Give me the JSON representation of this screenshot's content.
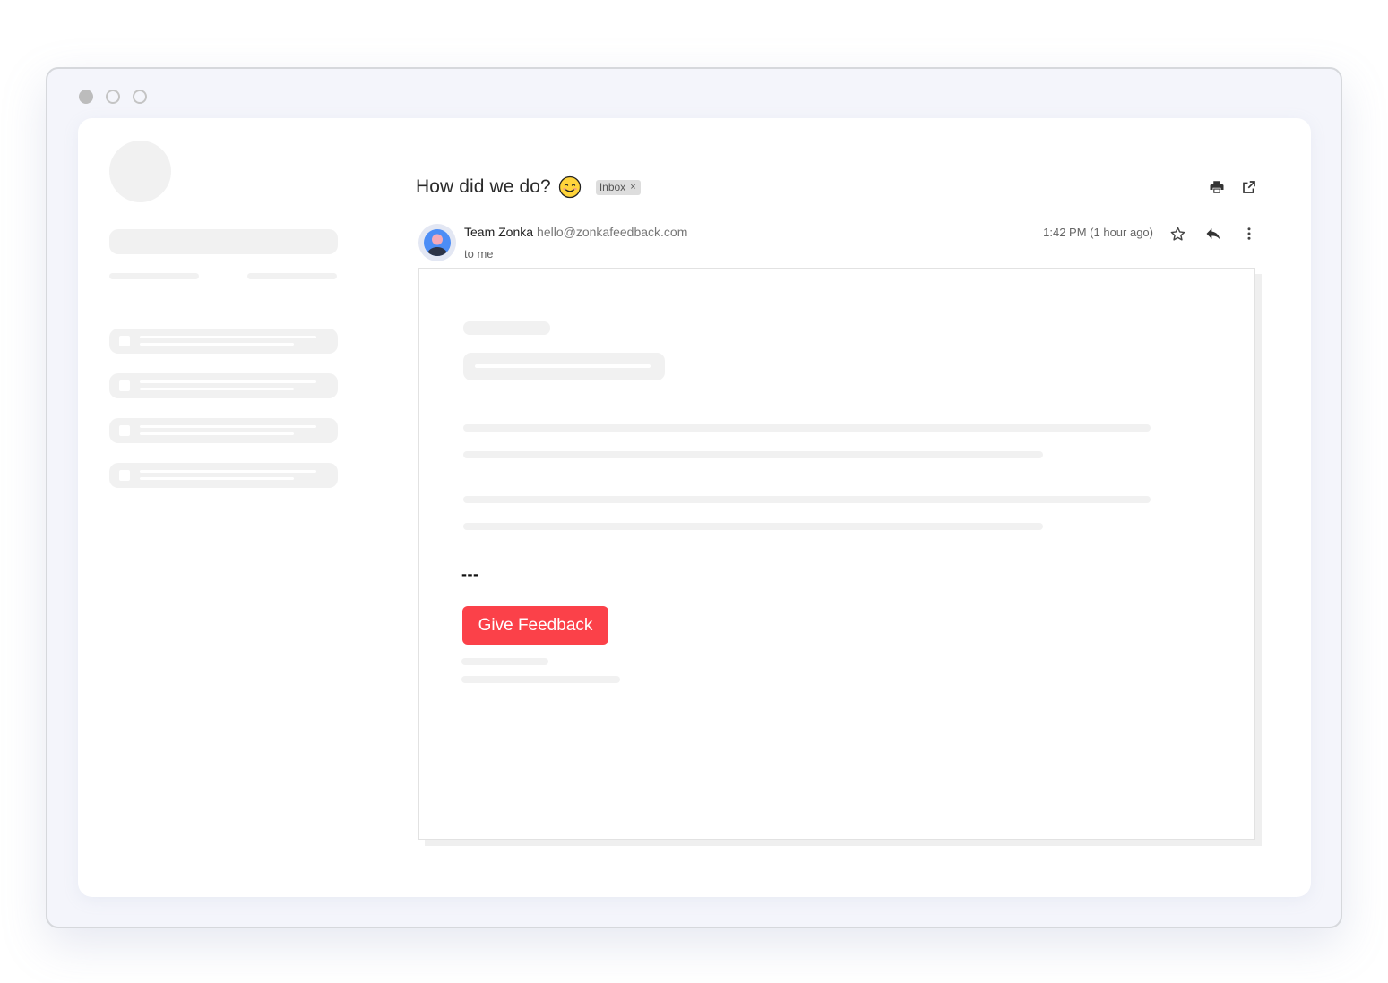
{
  "email": {
    "subject": "How did we do?",
    "subject_emoji": "smiling-face-icon",
    "label": "Inbox",
    "label_close": "×",
    "sender_name": "Team Zonka",
    "sender_email": "hello@zonkafeedback.com",
    "recipient": "to me",
    "timestamp": "1:42 PM (1 hour ago)",
    "separator": "---",
    "cta_label": "Give Feedback"
  },
  "icons": {
    "print": "print-icon",
    "open_new_window": "open-in-new-window-icon",
    "star": "star-icon",
    "reply": "reply-icon",
    "more": "more-vertical-icon",
    "avatar": "user-avatar-icon"
  },
  "colors": {
    "cta_background": "#fb4149",
    "skeleton": "#f1f1f1",
    "avatar_blue": "#4c8df6"
  }
}
